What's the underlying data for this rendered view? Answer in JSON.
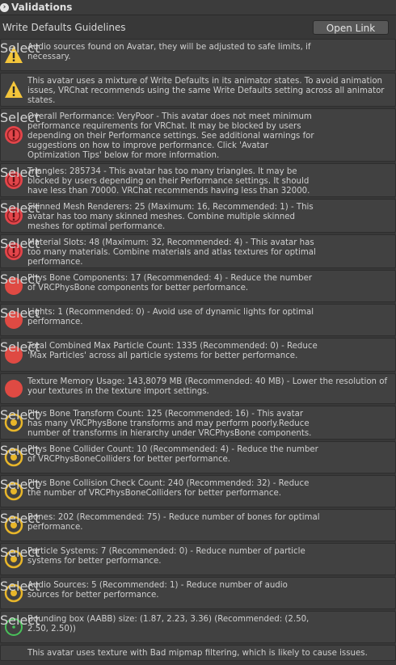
{
  "panel": {
    "title": "Validations"
  },
  "header": {
    "label": "Write Defaults Guidelines",
    "open_link": "Open Link"
  },
  "select_label": "Select",
  "items": [
    {
      "kind": "warning",
      "text": "Audio sources found on Avatar, they will be adjusted to safe limits, if necessary.",
      "button": true
    },
    {
      "kind": "warning",
      "text": "This avatar uses a mixture of Write Defaults in its animator states. To avoid animation issues, VRChat recommends using the same Write Defaults setting across all animator states.",
      "button": false
    },
    {
      "kind": "error",
      "text": "Overall Performance: VeryPoor - This avatar does not meet minimum performance requirements for VRChat. It may be blocked by users depending on their Performance settings. See additional warnings for suggestions on how to improve performance. Click 'Avatar Optimization Tips' below for more information.",
      "button": true
    },
    {
      "kind": "error",
      "text": "Triangles: 285734 - This avatar has too many triangles. It may be blocked by users depending on their Performance settings. It should have less than 70000. VRChat recommends having less than 32000.",
      "button": true
    },
    {
      "kind": "error",
      "text": "Skinned Mesh Renderers: 25 (Maximum: 16, Recommended: 1) - This avatar has too many skinned meshes. Combine multiple skinned meshes for optimal performance.",
      "button": true
    },
    {
      "kind": "error",
      "text": "Material Slots: 48 (Maximum: 32, Recommended: 4) - This avatar has too many materials. Combine materials and atlas textures for optimal performance.",
      "button": true
    },
    {
      "kind": "verypoor",
      "text": "Phys Bone Components: 17 (Recommended: 4) - Reduce the number of VRCPhysBone components for better performance.",
      "button": true
    },
    {
      "kind": "verypoor",
      "text": "Lights: 1 (Recommended: 0) - Avoid use of dynamic lights for optimal performance.",
      "button": true
    },
    {
      "kind": "verypoor",
      "text": "Total Combined Max Particle Count: 1335 (Recommended: 0) - Reduce 'Max Particles' across all particle systems for better performance.",
      "button": true
    },
    {
      "kind": "verypoor",
      "text": "Texture Memory Usage: 143,8079 MB (Recommended: 40 MB) - Lower the resolution of your textures in the texture import settings.",
      "button": false
    },
    {
      "kind": "poor",
      "text": "Phys Bone Transform Count: 125 (Recommended: 16) - This avatar has many VRCPhysBone transforms and may perform poorly.Reduce number of transforms in hierarchy under VRCPhysBone components.",
      "button": true
    },
    {
      "kind": "poor",
      "text": "Phys Bone Collider Count: 10 (Recommended: 4) - Reduce the number of VRCPhysBoneColliders for better performance.",
      "button": true
    },
    {
      "kind": "poor",
      "text": "Phys Bone Collision Check Count: 240 (Recommended: 32) - Reduce the number of VRCPhysBoneColliders for better performance.",
      "button": true
    },
    {
      "kind": "poor",
      "text": "Bones: 202 (Recommended: 75) - Reduce number of bones for optimal performance.",
      "button": true
    },
    {
      "kind": "poor",
      "text": "Particle Systems: 7 (Recommended: 0) - Reduce number of particle systems for better performance.",
      "button": true
    },
    {
      "kind": "poor",
      "text": "Audio Sources: 5 (Recommended: 1) - Reduce number of audio sources for better performance.",
      "button": true
    },
    {
      "kind": "good",
      "text": "Bounding box (AABB) size: (1.87, 2.23, 3.36) (Recommended: (2.50, 2.50, 2.50))",
      "button": true
    },
    {
      "kind": "info",
      "text": "This avatar uses texture with Bad mipmap filtering, which is likely to cause issues.",
      "button": false
    }
  ],
  "colors": {
    "warning": "#f3c53b",
    "error": "#e3454a",
    "verypoor": "#df4a43",
    "poor": "#e8b62a",
    "good": "#49c25a"
  }
}
